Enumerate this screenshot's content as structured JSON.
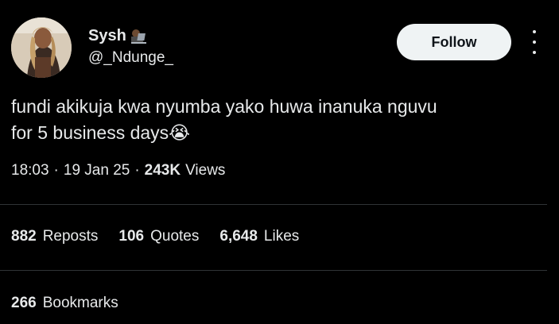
{
  "author": {
    "name": "Sysh",
    "name_emoji": "laptop-person-icon",
    "handle": "@_Ndunge_"
  },
  "follow_label": "Follow",
  "tweet": {
    "text_line1": "fundi akikuja kwa nyumba yako huwa inanuka nguvu",
    "text_line2": "for 5 business days",
    "emoji": "😭"
  },
  "meta": {
    "time": "18:03",
    "date": "19 Jan 25",
    "views_count": "243K",
    "views_label": "Views"
  },
  "stats": {
    "reposts_count": "882",
    "reposts_label": "Reposts",
    "quotes_count": "106",
    "quotes_label": "Quotes",
    "likes_count": "6,648",
    "likes_label": "Likes",
    "bookmarks_count": "266",
    "bookmarks_label": "Bookmarks"
  }
}
